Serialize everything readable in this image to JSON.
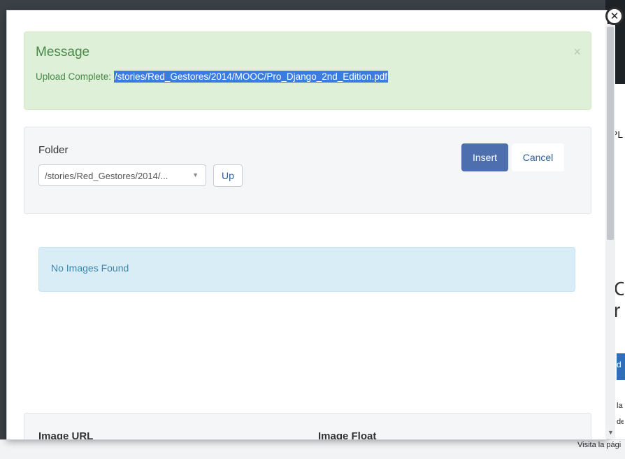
{
  "background": {
    "bottom_text": "Visita la pági",
    "fragments": [
      "PL",
      "C",
      "r",
      "d",
      "la",
      "de"
    ]
  },
  "alert": {
    "title": "Message",
    "prefix": "Upload Complete: ",
    "path": "/stories/Red_Gestores/2014/MOOC/Pro_Django_2nd_Edition.pdf",
    "close_glyph": "×"
  },
  "folder": {
    "label": "Folder",
    "selected": "/stories/Red_Gestores/2014/...",
    "up_label": "Up"
  },
  "actions": {
    "insert_label": "Insert",
    "cancel_label": "Cancel"
  },
  "info": {
    "message": "No Images Found"
  },
  "fields": {
    "image_url_label": "Image URL",
    "image_float_label": "Image Float"
  },
  "icons": {
    "close": "close-circle-icon",
    "select_caret": "chevron-down-icon"
  },
  "colors": {
    "success_bg": "#dff0d8",
    "success_text": "#468847",
    "info_bg": "#d9edf7",
    "info_text": "#3a87ad",
    "primary": "#4e6fad"
  }
}
